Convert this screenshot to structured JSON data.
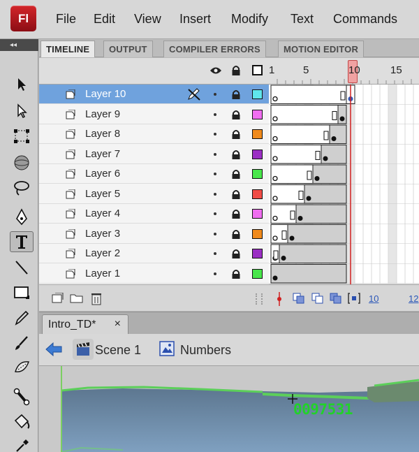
{
  "app": {
    "logo": "Fl"
  },
  "menu": [
    "File",
    "Edit",
    "View",
    "Insert",
    "Modify",
    "Text",
    "Commands"
  ],
  "tools_header": "◂◂",
  "panel_tabs": [
    "TIMELINE",
    "OUTPUT",
    "COMPILER ERRORS",
    "MOTION EDITOR"
  ],
  "ruler": {
    "labels": [
      "1",
      "5",
      "10",
      "15"
    ],
    "current_frame_label": "10"
  },
  "layers": [
    {
      "name": "Layer 10",
      "color": "#5fe6ec",
      "keyframe": 9,
      "selected": true
    },
    {
      "name": "Layer 9",
      "color": "#f06ef0",
      "keyframe": 8
    },
    {
      "name": "Layer 8",
      "color": "#f08a1c",
      "keyframe": 7
    },
    {
      "name": "Layer 7",
      "color": "#9b2fc4",
      "keyframe": 6
    },
    {
      "name": "Layer 6",
      "color": "#49e64b",
      "keyframe": 5
    },
    {
      "name": "Layer 5",
      "color": "#f14c46",
      "keyframe": 4
    },
    {
      "name": "Layer 4",
      "color": "#f06ef0",
      "keyframe": 3
    },
    {
      "name": "Layer 3",
      "color": "#f08a1c",
      "keyframe": 2
    },
    {
      "name": "Layer 2",
      "color": "#9b2fc4",
      "keyframe": 1
    },
    {
      "name": "Layer 1",
      "color": "#49e64b",
      "keyframe": 0
    }
  ],
  "footer": {
    "current_frame": "10",
    "next_value": "12"
  },
  "document": {
    "tab_name": "Intro_TD*",
    "close": "×"
  },
  "breadcrumb": {
    "scene": "Scene 1",
    "symbol": "Numbers"
  },
  "stage": {
    "counter_text": "0097531"
  }
}
